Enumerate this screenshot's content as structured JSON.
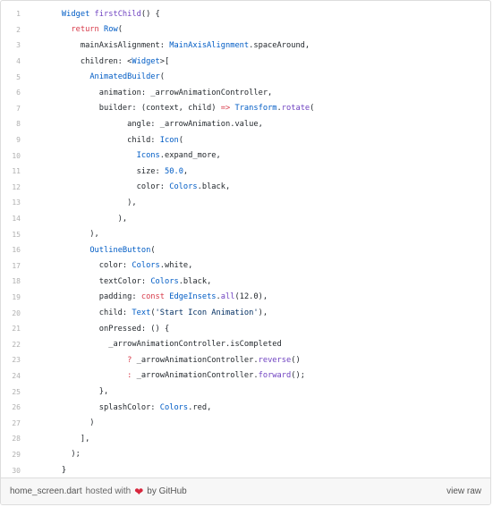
{
  "code_lines": [
    {
      "n": "1",
      "tokens": [
        {
          "t": "    "
        },
        {
          "t": "Widget",
          "c": "ty"
        },
        {
          "t": " "
        },
        {
          "t": "firstChild",
          "c": "fn"
        },
        {
          "t": "() {"
        }
      ]
    },
    {
      "n": "2",
      "tokens": [
        {
          "t": "      "
        },
        {
          "t": "return",
          "c": "kw"
        },
        {
          "t": " "
        },
        {
          "t": "Row",
          "c": "ty"
        },
        {
          "t": "("
        }
      ]
    },
    {
      "n": "3",
      "tokens": [
        {
          "t": "        mainAxisAlignment: "
        },
        {
          "t": "MainAxisAlignment",
          "c": "ty"
        },
        {
          "t": ".spaceAround,"
        }
      ]
    },
    {
      "n": "4",
      "tokens": [
        {
          "t": "        children: <"
        },
        {
          "t": "Widget",
          "c": "ty"
        },
        {
          "t": ">["
        }
      ]
    },
    {
      "n": "5",
      "tokens": [
        {
          "t": "          "
        },
        {
          "t": "AnimatedBuilder",
          "c": "ty"
        },
        {
          "t": "("
        }
      ]
    },
    {
      "n": "6",
      "tokens": [
        {
          "t": "            animation: _arrowAnimationController,"
        }
      ]
    },
    {
      "n": "7",
      "tokens": [
        {
          "t": "            builder: (context, child) "
        },
        {
          "t": "=>",
          "c": "kw"
        },
        {
          "t": " "
        },
        {
          "t": "Transform",
          "c": "ty"
        },
        {
          "t": "."
        },
        {
          "t": "rotate",
          "c": "fn"
        },
        {
          "t": "("
        }
      ]
    },
    {
      "n": "8",
      "tokens": [
        {
          "t": "                  angle: _arrowAnimation.value,"
        }
      ]
    },
    {
      "n": "9",
      "tokens": [
        {
          "t": "                  child: "
        },
        {
          "t": "Icon",
          "c": "ty"
        },
        {
          "t": "("
        }
      ]
    },
    {
      "n": "10",
      "tokens": [
        {
          "t": "                    "
        },
        {
          "t": "Icons",
          "c": "ty"
        },
        {
          "t": ".expand_more,"
        }
      ]
    },
    {
      "n": "11",
      "tokens": [
        {
          "t": "                    size: "
        },
        {
          "t": "50.0",
          "c": "nm"
        },
        {
          "t": ","
        }
      ]
    },
    {
      "n": "12",
      "tokens": [
        {
          "t": "                    color: "
        },
        {
          "t": "Colors",
          "c": "ty"
        },
        {
          "t": ".black,"
        }
      ]
    },
    {
      "n": "13",
      "tokens": [
        {
          "t": "                  ),"
        }
      ]
    },
    {
      "n": "14",
      "tokens": [
        {
          "t": "                ),"
        }
      ]
    },
    {
      "n": "15",
      "tokens": [
        {
          "t": "          ),"
        }
      ]
    },
    {
      "n": "16",
      "tokens": [
        {
          "t": "          "
        },
        {
          "t": "OutlineButton",
          "c": "ty"
        },
        {
          "t": "("
        }
      ]
    },
    {
      "n": "17",
      "tokens": [
        {
          "t": "            color: "
        },
        {
          "t": "Colors",
          "c": "ty"
        },
        {
          "t": ".white,"
        }
      ]
    },
    {
      "n": "18",
      "tokens": [
        {
          "t": "            textColor: "
        },
        {
          "t": "Colors",
          "c": "ty"
        },
        {
          "t": ".black,"
        }
      ]
    },
    {
      "n": "19",
      "tokens": [
        {
          "t": "            padding: "
        },
        {
          "t": "const",
          "c": "kw"
        },
        {
          "t": " "
        },
        {
          "t": "EdgeInsets",
          "c": "ty"
        },
        {
          "t": "."
        },
        {
          "t": "all",
          "c": "fn"
        },
        {
          "t": "(12.0),"
        }
      ]
    },
    {
      "n": "20",
      "tokens": [
        {
          "t": "            child: "
        },
        {
          "t": "Text",
          "c": "ty"
        },
        {
          "t": "("
        },
        {
          "t": "'Start Icon Animation'",
          "c": "st"
        },
        {
          "t": "),"
        }
      ]
    },
    {
      "n": "21",
      "tokens": [
        {
          "t": "            onPressed: () {"
        }
      ]
    },
    {
      "n": "22",
      "tokens": [
        {
          "t": "              _arrowAnimationController.isCompleted"
        }
      ]
    },
    {
      "n": "23",
      "tokens": [
        {
          "t": "                  "
        },
        {
          "t": "?",
          "c": "kw"
        },
        {
          "t": " _arrowAnimationController."
        },
        {
          "t": "reverse",
          "c": "fn"
        },
        {
          "t": "()"
        }
      ]
    },
    {
      "n": "24",
      "tokens": [
        {
          "t": "                  "
        },
        {
          "t": ":",
          "c": "kw"
        },
        {
          "t": " _arrowAnimationController."
        },
        {
          "t": "forward",
          "c": "fn"
        },
        {
          "t": "();"
        }
      ]
    },
    {
      "n": "25",
      "tokens": [
        {
          "t": "            },"
        }
      ]
    },
    {
      "n": "26",
      "tokens": [
        {
          "t": "            splashColor: "
        },
        {
          "t": "Colors",
          "c": "ty"
        },
        {
          "t": ".red,"
        }
      ]
    },
    {
      "n": "27",
      "tokens": [
        {
          "t": "          )"
        }
      ]
    },
    {
      "n": "28",
      "tokens": [
        {
          "t": "        ],"
        }
      ]
    },
    {
      "n": "29",
      "tokens": [
        {
          "t": "      );"
        }
      ]
    },
    {
      "n": "30",
      "tokens": [
        {
          "t": "    }"
        }
      ]
    }
  ],
  "footer": {
    "filename": "home_screen.dart",
    "hosted_with": "hosted with",
    "heart_icon": "heart-icon",
    "by": "by GitHub",
    "view_raw": "view raw"
  },
  "colors": {
    "keyword": "#d73a49",
    "type": "#005cc5",
    "function": "#6f42c1",
    "string": "#032f62",
    "heart": "#d7263d"
  }
}
